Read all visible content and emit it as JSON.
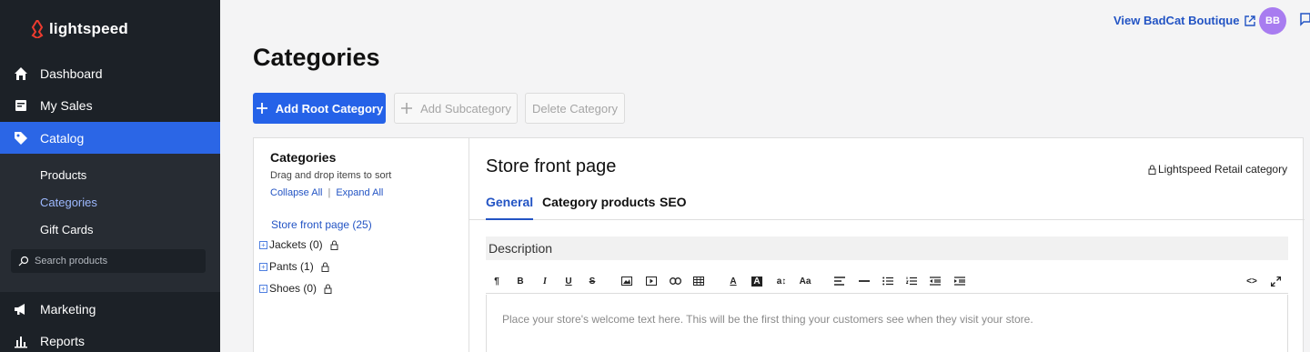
{
  "brand": {
    "name": "lightspeed"
  },
  "sidebar": {
    "items": [
      {
        "label": "Dashboard",
        "icon": "home-icon"
      },
      {
        "label": "My Sales",
        "icon": "receipt-icon"
      },
      {
        "label": "Catalog",
        "icon": "tag-icon",
        "active": true
      },
      {
        "label": "Marketing",
        "icon": "megaphone-icon"
      },
      {
        "label": "Reports",
        "icon": "chart-icon"
      }
    ],
    "subitems": [
      {
        "label": "Products"
      },
      {
        "label": "Categories",
        "active": true
      },
      {
        "label": "Gift Cards"
      }
    ],
    "search_placeholder": "Search products"
  },
  "header": {
    "store_link": "View BadCat Boutique",
    "avatar_initials": "BB"
  },
  "page": {
    "title": "Categories",
    "buttons": {
      "add_root": "Add Root Category",
      "add_sub": "Add Subcategory",
      "delete": "Delete Category"
    }
  },
  "tree": {
    "title": "Categories",
    "hint": "Drag and drop items to sort",
    "collapse": "Collapse All",
    "separator": "|",
    "expand": "Expand All",
    "root": "Store front page (25)",
    "nodes": [
      {
        "label": "Jackets (0)"
      },
      {
        "label": "Pants (1)"
      },
      {
        "label": "Shoes (0)"
      }
    ]
  },
  "detail": {
    "title": "Store front page",
    "badge": "Lightspeed Retail category",
    "tabs": [
      {
        "label": "General",
        "active": true
      },
      {
        "label": "Category products"
      },
      {
        "label": "SEO"
      }
    ],
    "description_label": "Description",
    "editor_placeholder": "Place your store's welcome text here. This will be the first thing your customers see when they visit your store."
  },
  "colors": {
    "sidebar_bg": "#1c2127",
    "accent": "#2562e8",
    "link": "#2354c4",
    "avatar": "#a87cf0"
  }
}
